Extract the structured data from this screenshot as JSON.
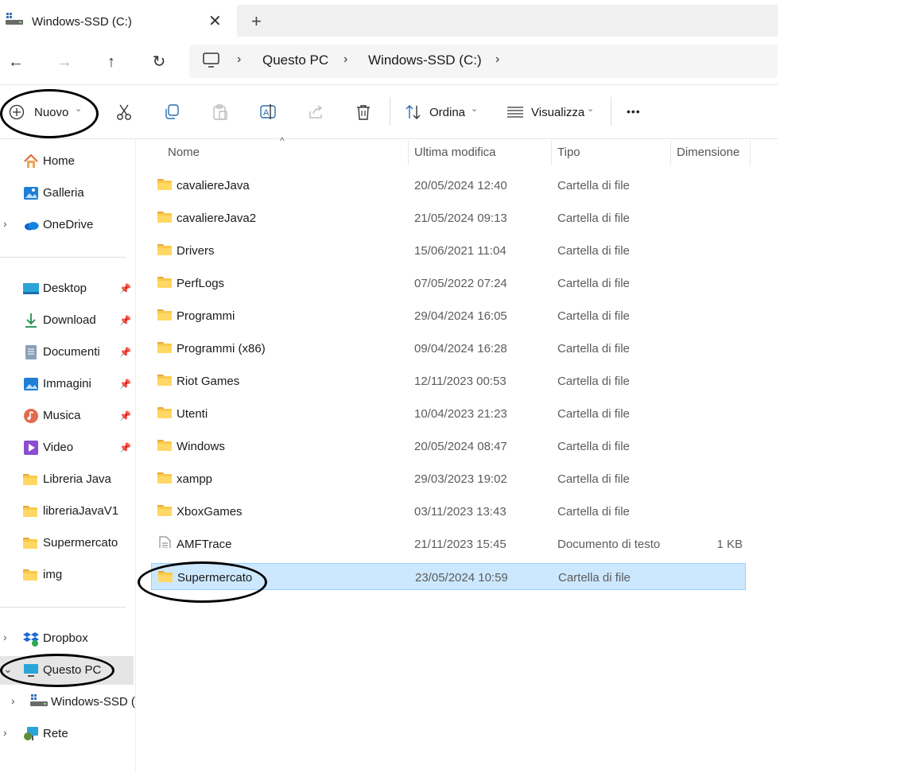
{
  "window": {
    "tab_title": "Windows-SSD (C:)",
    "tab_close": "✕",
    "new_tab": "+"
  },
  "nav": {
    "back": "←",
    "forward": "→",
    "up": "↑",
    "refresh": "↻",
    "chevron": "›",
    "breadcrumbs": [
      "Questo PC",
      "Windows-SSD (C:)"
    ]
  },
  "toolbar": {
    "new_label": "Nuovo",
    "sort_label": "Ordina",
    "view_label": "Visualizza",
    "more_label": "•••",
    "dropdown_caret": "⌄"
  },
  "sidebar": {
    "top": [
      {
        "label": "Home",
        "icon": "home-icon"
      },
      {
        "label": "Galleria",
        "icon": "gallery-icon"
      },
      {
        "label": "OneDrive",
        "icon": "onedrive-icon"
      }
    ],
    "quick": [
      {
        "label": "Desktop",
        "icon": "desktop-icon",
        "pinned": true
      },
      {
        "label": "Download",
        "icon": "download-icon",
        "pinned": true
      },
      {
        "label": "Documenti",
        "icon": "documents-icon",
        "pinned": true
      },
      {
        "label": "Immagini",
        "icon": "pictures-icon",
        "pinned": true
      },
      {
        "label": "Musica",
        "icon": "music-icon",
        "pinned": true
      },
      {
        "label": "Video",
        "icon": "video-icon",
        "pinned": true
      },
      {
        "label": "Libreria Java",
        "icon": "folder-icon",
        "pinned": false
      },
      {
        "label": "libreriaJavaV1",
        "icon": "folder-icon",
        "pinned": false
      },
      {
        "label": "Supermercato",
        "icon": "folder-icon",
        "pinned": false
      },
      {
        "label": "img",
        "icon": "folder-icon",
        "pinned": false
      }
    ],
    "bottom": [
      {
        "label": "Dropbox",
        "icon": "dropbox-icon"
      },
      {
        "label": "Questo PC",
        "icon": "this-pc-icon"
      },
      {
        "label": "Windows-SSD (C:)",
        "icon": "drive-icon"
      },
      {
        "label": "Rete",
        "icon": "network-icon"
      }
    ],
    "pin_glyph": "📌",
    "expand_glyph": "›",
    "expanded_glyph": "⌄"
  },
  "list": {
    "columns": [
      "Nome",
      "Ultima modifica",
      "Tipo",
      "Dimensione"
    ],
    "sort_caret": "^",
    "rows": [
      {
        "name": "cavaliereJava",
        "date": "20/05/2024 12:40",
        "type": "Cartella di file",
        "size": "",
        "kind": "folder"
      },
      {
        "name": "cavaliereJava2",
        "date": "21/05/2024 09:13",
        "type": "Cartella di file",
        "size": "",
        "kind": "folder"
      },
      {
        "name": "Drivers",
        "date": "15/06/2021 11:04",
        "type": "Cartella di file",
        "size": "",
        "kind": "folder"
      },
      {
        "name": "PerfLogs",
        "date": "07/05/2022 07:24",
        "type": "Cartella di file",
        "size": "",
        "kind": "folder"
      },
      {
        "name": "Programmi",
        "date": "29/04/2024 16:05",
        "type": "Cartella di file",
        "size": "",
        "kind": "folder"
      },
      {
        "name": "Programmi (x86)",
        "date": "09/04/2024 16:28",
        "type": "Cartella di file",
        "size": "",
        "kind": "folder"
      },
      {
        "name": "Riot Games",
        "date": "12/11/2023 00:53",
        "type": "Cartella di file",
        "size": "",
        "kind": "folder"
      },
      {
        "name": "Utenti",
        "date": "10/04/2023 21:23",
        "type": "Cartella di file",
        "size": "",
        "kind": "folder"
      },
      {
        "name": "Windows",
        "date": "20/05/2024 08:47",
        "type": "Cartella di file",
        "size": "",
        "kind": "folder"
      },
      {
        "name": "xampp",
        "date": "29/03/2023 19:02",
        "type": "Cartella di file",
        "size": "",
        "kind": "folder"
      },
      {
        "name": "XboxGames",
        "date": "03/11/2023 13:43",
        "type": "Cartella di file",
        "size": "",
        "kind": "folder"
      },
      {
        "name": "AMFTrace",
        "date": "21/11/2023 15:45",
        "type": "Documento di testo",
        "size": "1 KB",
        "kind": "text"
      },
      {
        "name": "Supermercato",
        "date": "23/05/2024 10:59",
        "type": "Cartella di file",
        "size": "",
        "kind": "folder",
        "selected": true
      }
    ]
  },
  "colors": {
    "selection": "#cce8ff",
    "selection_border": "#99d1ff",
    "folder": "#f8c94a",
    "annotation": "#000000"
  }
}
